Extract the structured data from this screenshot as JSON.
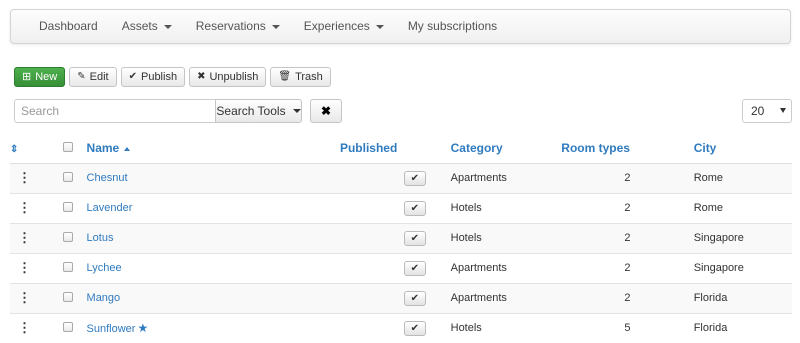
{
  "nav": {
    "items": [
      {
        "label": "Dashboard",
        "dropdown": false
      },
      {
        "label": "Assets",
        "dropdown": true
      },
      {
        "label": "Reservations",
        "dropdown": true
      },
      {
        "label": "Experiences",
        "dropdown": true
      },
      {
        "label": "My subscriptions",
        "dropdown": false
      }
    ]
  },
  "toolbar": {
    "new_label": "New",
    "edit_label": "Edit",
    "publish_label": "Publish",
    "unpublish_label": "Unpublish",
    "trash_label": "Trash"
  },
  "search": {
    "placeholder": "Search",
    "tools_label": "Search Tools",
    "limit_value": "20"
  },
  "table": {
    "headers": {
      "name": "Name",
      "published": "Published",
      "category": "Category",
      "room_types": "Room types",
      "city": "City"
    },
    "rows": [
      {
        "name": "Chesnut",
        "featured": false,
        "published": true,
        "category": "Apartments",
        "room_types": "2",
        "city": "Rome"
      },
      {
        "name": "Lavender",
        "featured": false,
        "published": true,
        "category": "Hotels",
        "room_types": "2",
        "city": "Rome"
      },
      {
        "name": "Lotus",
        "featured": false,
        "published": true,
        "category": "Hotels",
        "room_types": "2",
        "city": "Singapore"
      },
      {
        "name": "Lychee",
        "featured": false,
        "published": true,
        "category": "Apartments",
        "room_types": "2",
        "city": "Singapore"
      },
      {
        "name": "Mango",
        "featured": false,
        "published": true,
        "category": "Apartments",
        "room_types": "2",
        "city": "Florida"
      },
      {
        "name": "Sunflower",
        "featured": true,
        "published": true,
        "category": "Hotels",
        "room_types": "5",
        "city": "Florida"
      }
    ]
  },
  "colors": {
    "link": "#2f7bbf",
    "new_button": "#44a544"
  }
}
